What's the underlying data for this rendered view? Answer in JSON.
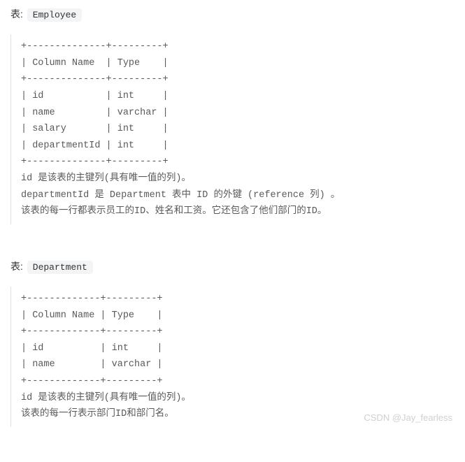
{
  "sections": [
    {
      "label_prefix": "表: ",
      "table_name": "Employee",
      "schema": "+--------------+---------+\n| Column Name  | Type    |\n+--------------+---------+\n| id           | int     |\n| name         | varchar |\n| salary       | int     |\n| departmentId | int     |\n+--------------+---------+",
      "description": "id 是该表的主键列(具有唯一值的列)。\ndepartmentId 是 Department 表中 ID 的外键 (reference 列) 。\n该表的每一行都表示员工的ID、姓名和工资。它还包含了他们部门的ID。"
    },
    {
      "label_prefix": "表: ",
      "table_name": "Department",
      "schema": "+-------------+---------+\n| Column Name | Type    |\n+-------------+---------+\n| id          | int     |\n| name        | varchar |\n+-------------+---------+",
      "description": "id 是该表的主键列(具有唯一值的列)。\n该表的每一行表示部门ID和部门名。"
    }
  ],
  "watermark": "CSDN @Jay_fearless"
}
